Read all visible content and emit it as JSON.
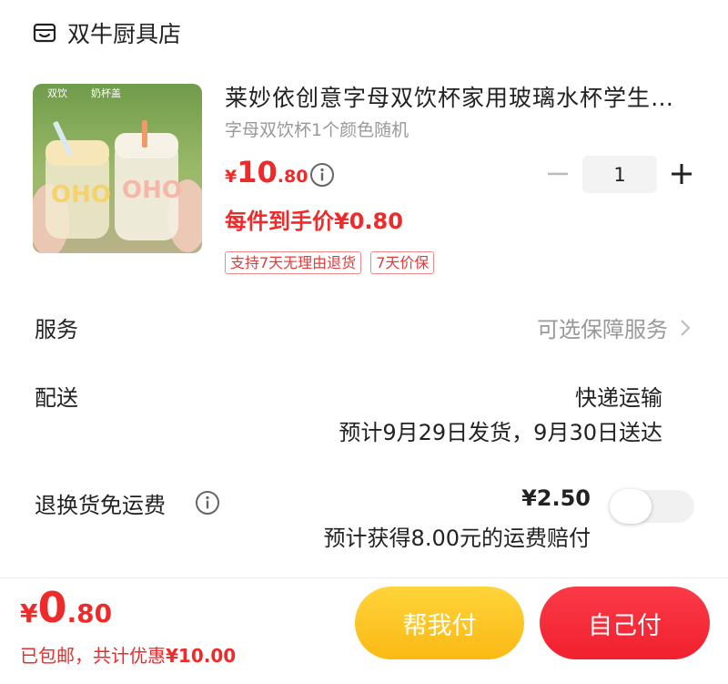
{
  "shop": {
    "name": "双牛厨具店",
    "icon": "store-icon"
  },
  "product": {
    "title": "莱妙依创意字母双饮杯家用玻璃水杯学生…",
    "spec": "字母双饮杯1个颜色随机",
    "price_currency": "¥",
    "price_int": "10",
    "price_dec": ".80",
    "final_price": "每件到手价¥0.80",
    "quantity": "1",
    "tags": [
      "支持7天无理由退货",
      "7天价保"
    ],
    "image_text": [
      "双饮",
      "奶杯盖",
      "OHO"
    ]
  },
  "service": {
    "label": "服务",
    "value": "可选保障服务"
  },
  "delivery": {
    "label": "配送",
    "method": "快递运输",
    "eta": "预计9月29日发货，9月30日送达"
  },
  "return_shipping": {
    "label": "退换货免运费",
    "price": "¥2.50",
    "note": "预计获得8.00元的运费赔付",
    "enabled": false
  },
  "footer": {
    "total_currency": "¥",
    "total_int": "0",
    "total_dec": ".80",
    "shipping_prefix": "已包邮，共计优惠",
    "discount": "¥10.00",
    "help_pay_label": "帮我付",
    "self_pay_label": "自己付"
  },
  "colors": {
    "accent_red": "#ee2b2b",
    "help_btn": "#fbc224",
    "self_btn": "#f3262f"
  }
}
